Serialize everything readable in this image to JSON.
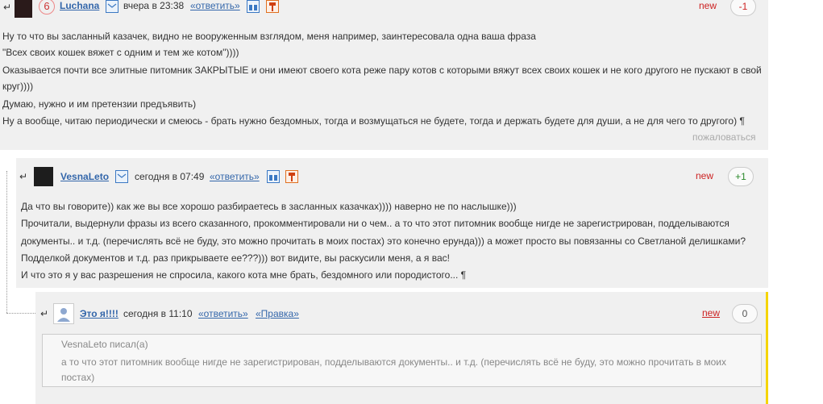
{
  "comment1": {
    "author": "Luchana",
    "rank": "6",
    "date": "вчера в 23:38",
    "reply": "«ответить»",
    "new": "new",
    "vote": "-1",
    "lines": [
      "Ну то что вы засланный казачек, видно не вооруженным взглядом, меня например, заинтересовала одна ваша фраза",
      "\"Всех своих кошек вяжет с одним и тем же котом\"))))",
      "Оказывается почти все элитные питомник ЗАКРЫТЫЕ и они имеют своего кота реже пару котов с которыми вяжут всех своих кошек и не кого другого не пускают в свой",
      "круг))))",
      "Думаю, нужно и им претензии предъявить)",
      "Ну а вообще, читаю периодически и смеюсь - брать нужно бездомных, тогда и возмущаться не будете, тогда и держать будете для души, а не для чего то другого) ¶"
    ],
    "complain": "пожаловаться"
  },
  "comment2": {
    "author": "VesnaLeto",
    "date": "сегодня в 07:49",
    "reply": "«ответить»",
    "new": "new",
    "vote": "+1",
    "lines": [
      "Да что вы говорите)) как же вы все хорошо разбираетесь в засланных казачках)))) наверно не по наслышке)))",
      "Прочитали, выдернули фразы из всего сказанного, прокомментировали ни о чем.. а то что этот питомник вообще нигде не зарегистрирован, подделываются",
      "документы.. и т.д. (перечислять всё не буду, это можно прочитать в моих постах) это конечно ерунда))) а может просто вы повязанны со Светланой делишками?",
      "Подделкой документов и т.д. раз прикрываете ее???))) вот видите, вы раскусили меня, а я вас!",
      "И что это я у вас разрешения не спросила, какого кота мне брать, бездомного или породистого... ¶"
    ]
  },
  "comment3": {
    "author": "Это я!!!!",
    "date": "сегодня в 11:10",
    "reply": "«ответить»",
    "edit": "«Правка»",
    "new": "new",
    "vote": "0",
    "quote_author": "VesnaLeto писал(а)",
    "quote_lines": [
      "а то что этот питомник вообще нигде не зарегистрирован, подделываются документы.. и т.д. (перечислять всё не буду, это можно прочитать в моих",
      "постах)"
    ]
  },
  "arrow": "↵"
}
